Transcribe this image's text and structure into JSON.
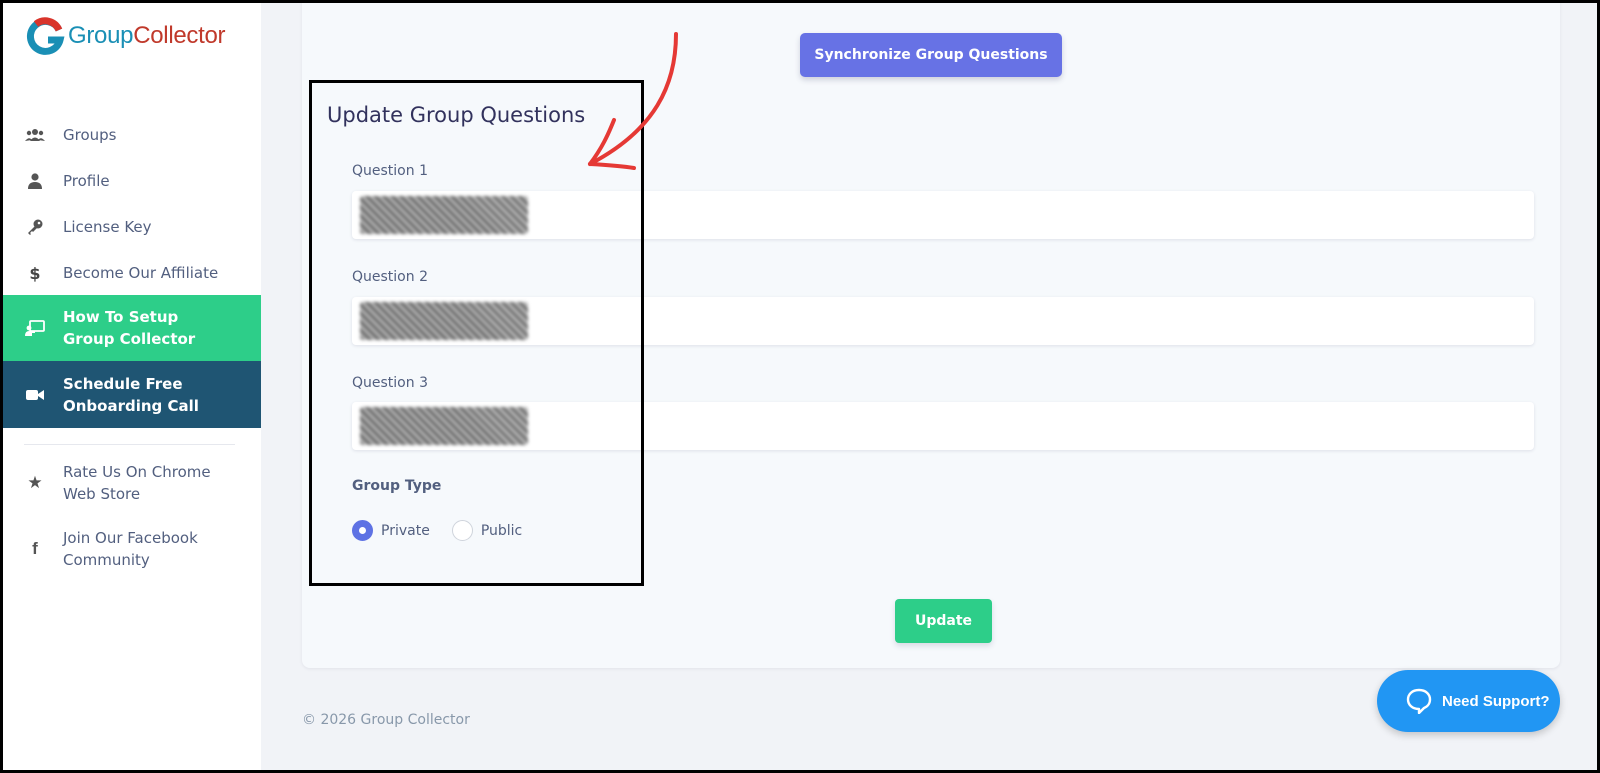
{
  "brand": {
    "part1": "Group",
    "part2": "Collector"
  },
  "sidebar": {
    "items": [
      {
        "label": "Groups",
        "icon": "users-icon"
      },
      {
        "label": "Profile",
        "icon": "user-icon"
      },
      {
        "label": "License Key",
        "icon": "key-icon"
      },
      {
        "label": "Become Our Affiliate",
        "icon": "dollar-icon"
      },
      {
        "label": "How To Setup Group Collector",
        "icon": "chalkboard-icon",
        "state": "active"
      },
      {
        "label": "Schedule Free Onboarding Call",
        "icon": "video-icon",
        "state": "highlighted"
      },
      {
        "label": "Rate Us On Chrome Web Store",
        "icon": "star-icon"
      },
      {
        "label": "Join Our Facebook Community",
        "icon": "facebook-icon"
      }
    ]
  },
  "main": {
    "sync_button": "Synchronize Group Questions",
    "title": "Update Group Questions",
    "questions": [
      {
        "label": "Question 1"
      },
      {
        "label": "Question 2"
      },
      {
        "label": "Question 3"
      }
    ],
    "group_type": {
      "label": "Group Type",
      "options": [
        "Private",
        "Public"
      ],
      "selected": "Private"
    },
    "update_button": "Update"
  },
  "footer": {
    "copyright": "© 2026 Group Collector"
  },
  "support": {
    "label": "Need Support?"
  },
  "colors": {
    "primary": "#6772e5",
    "success": "#2dce89",
    "dark_nav": "#1f5573",
    "support": "#2196f3",
    "annotation_arrow": "#e53935"
  }
}
